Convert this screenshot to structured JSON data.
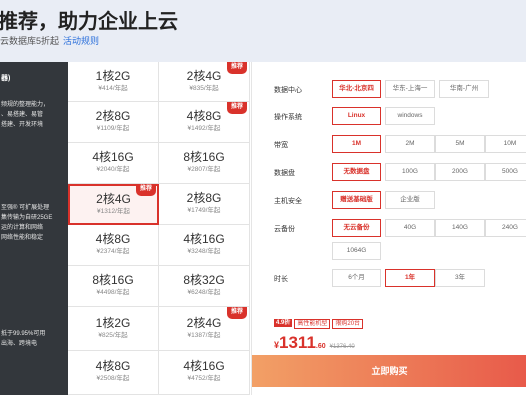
{
  "hero": {
    "title": "推荐，助力企业上云",
    "subtitle": "云数据库5折起",
    "link": "活动规则"
  },
  "left": {
    "block1_head": "器)",
    "block1_lines": [
      "频规的整理能力，",
      "、易搭建、易管",
      "搭建、开发环境"
    ],
    "block2_lines": [
      "至强® 可扩展处理",
      "集传输为自研25GE",
      "运的计算和网络",
      "网络性能和稳定"
    ],
    "block3_lines": [
      "抵于99.95%可用",
      "出海、跨境电"
    ]
  },
  "grid": {
    "cells": [
      {
        "spec": "1核2G",
        "price": "¥414/年起",
        "badge": ""
      },
      {
        "spec": "2核4G",
        "price": "¥835/年起",
        "badge": "推荐"
      },
      {
        "spec": "2核8G",
        "price": "¥1109/年起",
        "badge": ""
      },
      {
        "spec": "4核8G",
        "price": "¥1492/年起",
        "badge": "推荐"
      },
      {
        "spec": "4核16G",
        "price": "¥2040/年起",
        "badge": ""
      },
      {
        "spec": "8核16G",
        "price": "¥2807/年起",
        "badge": ""
      },
      {
        "spec": "2核4G",
        "price": "¥1312/年起",
        "badge": "推荐"
      },
      {
        "spec": "2核8G",
        "price": "¥1749/年起",
        "badge": ""
      },
      {
        "spec": "4核8G",
        "price": "¥2374/年起",
        "badge": ""
      },
      {
        "spec": "4核16G",
        "price": "¥3248/年起",
        "badge": ""
      },
      {
        "spec": "8核16G",
        "price": "¥4498/年起",
        "badge": ""
      },
      {
        "spec": "8核32G",
        "price": "¥6248/年起",
        "badge": ""
      },
      {
        "spec": "1核2G",
        "price": "¥825/年起",
        "badge": ""
      },
      {
        "spec": "2核4G",
        "price": "¥1387/年起",
        "badge": "推荐"
      },
      {
        "spec": "4核8G",
        "price": "¥2508/年起",
        "badge": ""
      },
      {
        "spec": "4核16G",
        "price": "¥4752/年起",
        "badge": ""
      }
    ]
  },
  "config": {
    "rows": [
      {
        "label": "数据中心",
        "options": [
          "华北-北京四",
          "华东-上海一",
          "华南-广州"
        ]
      },
      {
        "label": "操作系统",
        "options": [
          "Linux",
          "windows"
        ]
      },
      {
        "label": "带宽",
        "options": [
          "1M",
          "2M",
          "5M",
          "10M"
        ]
      },
      {
        "label": "数据盘",
        "options": [
          "无数据盘",
          "100G",
          "200G",
          "500G"
        ]
      },
      {
        "label": "主机安全",
        "options": [
          "赠送基础版",
          "企业版"
        ]
      },
      {
        "label": "云备份",
        "options": [
          "无云备份",
          "40G",
          "140G",
          "240G"
        ]
      },
      {
        "label": "",
        "options": [
          "1064G"
        ]
      },
      {
        "label": "时长",
        "options": [
          "6个月",
          "1年",
          "3年"
        ]
      }
    ],
    "active": [
      "华北-北京四",
      "Linux",
      "1M",
      "无数据盘",
      "赠送基础版",
      "无云备份",
      "1年"
    ]
  },
  "promo": {
    "tags": [
      "4.9折",
      "高性能机型",
      "限购20台"
    ],
    "currency": "¥",
    "price_int": "1311",
    "price_dec": ".60",
    "original": "¥1376.40",
    "buy_label": "立即购买"
  }
}
